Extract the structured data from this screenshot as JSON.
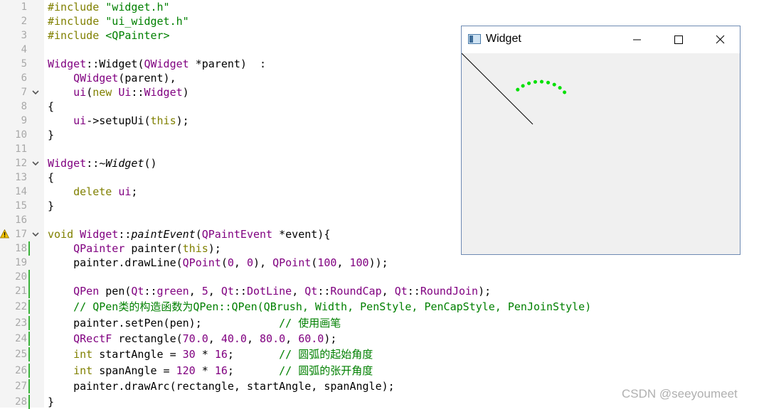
{
  "editor": {
    "lines": [
      {
        "n": "1",
        "fold": false,
        "warn": false,
        "mod": false,
        "tokens": [
          [
            "kw",
            "#include "
          ],
          [
            "str",
            "\"widget.h\""
          ]
        ]
      },
      {
        "n": "2",
        "fold": false,
        "warn": false,
        "mod": false,
        "tokens": [
          [
            "kw",
            "#include "
          ],
          [
            "str",
            "\"ui_widget.h\""
          ]
        ]
      },
      {
        "n": "3",
        "fold": false,
        "warn": false,
        "mod": false,
        "tokens": [
          [
            "kw",
            "#include "
          ],
          [
            "str",
            "<QPainter>"
          ]
        ]
      },
      {
        "n": "4",
        "fold": false,
        "warn": false,
        "mod": false,
        "tokens": []
      },
      {
        "n": "5",
        "fold": false,
        "warn": false,
        "mod": false,
        "tokens": [
          [
            "typ",
            "Widget"
          ],
          [
            "",
            "::"
          ],
          [
            "",
            "Widget"
          ],
          [
            "",
            "("
          ],
          [
            "typ",
            "QWidget"
          ],
          [
            "",
            " *parent)  :"
          ]
        ]
      },
      {
        "n": "6",
        "fold": false,
        "warn": false,
        "mod": false,
        "tokens": [
          [
            "",
            "    "
          ],
          [
            "typ",
            "QWidget"
          ],
          [
            "",
            "(parent),"
          ]
        ]
      },
      {
        "n": "7",
        "fold": true,
        "warn": false,
        "mod": false,
        "tokens": [
          [
            "",
            "    "
          ],
          [
            "typ",
            "ui"
          ],
          [
            "",
            "("
          ],
          [
            "kw",
            "new "
          ],
          [
            "typ",
            "Ui"
          ],
          [
            "",
            "::"
          ],
          [
            "typ",
            "Widget"
          ],
          [
            "",
            ")"
          ]
        ]
      },
      {
        "n": "8",
        "fold": false,
        "warn": false,
        "mod": false,
        "tokens": [
          [
            "",
            "{"
          ]
        ]
      },
      {
        "n": "9",
        "fold": false,
        "warn": false,
        "mod": false,
        "tokens": [
          [
            "",
            "    "
          ],
          [
            "typ",
            "ui"
          ],
          [
            "",
            "->setupUi("
          ],
          [
            "kw",
            "this"
          ],
          [
            "",
            ");"
          ]
        ]
      },
      {
        "n": "10",
        "fold": false,
        "warn": false,
        "mod": false,
        "tokens": [
          [
            "",
            "}"
          ]
        ]
      },
      {
        "n": "11",
        "fold": false,
        "warn": false,
        "mod": false,
        "tokens": []
      },
      {
        "n": "12",
        "fold": true,
        "warn": false,
        "mod": false,
        "tokens": [
          [
            "typ",
            "Widget"
          ],
          [
            "",
            "::~"
          ],
          [
            "it",
            "Widget"
          ],
          [
            "",
            "()"
          ]
        ]
      },
      {
        "n": "13",
        "fold": false,
        "warn": false,
        "mod": false,
        "tokens": [
          [
            "",
            "{"
          ]
        ]
      },
      {
        "n": "14",
        "fold": false,
        "warn": false,
        "mod": false,
        "tokens": [
          [
            "",
            "    "
          ],
          [
            "kw",
            "delete "
          ],
          [
            "typ",
            "ui"
          ],
          [
            "",
            ";"
          ]
        ]
      },
      {
        "n": "15",
        "fold": false,
        "warn": false,
        "mod": false,
        "tokens": [
          [
            "",
            "}"
          ]
        ]
      },
      {
        "n": "16",
        "fold": false,
        "warn": false,
        "mod": false,
        "tokens": []
      },
      {
        "n": "17",
        "fold": true,
        "warn": true,
        "mod": false,
        "tokens": [
          [
            "kw",
            "void "
          ],
          [
            "typ",
            "Widget"
          ],
          [
            "",
            "::"
          ],
          [
            "it",
            "paintEvent"
          ],
          [
            "",
            "("
          ],
          [
            "typ",
            "QPaintEvent"
          ],
          [
            "",
            " *event){"
          ]
        ]
      },
      {
        "n": "18",
        "fold": false,
        "warn": false,
        "mod": true,
        "tokens": [
          [
            "",
            "    "
          ],
          [
            "typ",
            "QPainter"
          ],
          [
            "",
            " painter("
          ],
          [
            "kw",
            "this"
          ],
          [
            "",
            ");"
          ]
        ]
      },
      {
        "n": "19",
        "fold": false,
        "warn": false,
        "mod": false,
        "tokens": [
          [
            "",
            "    painter.drawLine("
          ],
          [
            "typ",
            "QPoint"
          ],
          [
            "",
            "("
          ],
          [
            "typ",
            "0"
          ],
          [
            "",
            ", "
          ],
          [
            "typ",
            "0"
          ],
          [
            "",
            "), "
          ],
          [
            "typ",
            "QPoint"
          ],
          [
            "",
            "("
          ],
          [
            "typ",
            "100"
          ],
          [
            "",
            ", "
          ],
          [
            "typ",
            "100"
          ],
          [
            "",
            "));"
          ]
        ]
      },
      {
        "n": "20",
        "fold": false,
        "warn": false,
        "mod": true,
        "tokens": []
      },
      {
        "n": "21",
        "fold": false,
        "warn": false,
        "mod": true,
        "tokens": [
          [
            "",
            "    "
          ],
          [
            "typ",
            "QPen"
          ],
          [
            "",
            " pen("
          ],
          [
            "typ",
            "Qt"
          ],
          [
            "",
            "::"
          ],
          [
            "typ",
            "green"
          ],
          [
            "",
            ", "
          ],
          [
            "typ",
            "5"
          ],
          [
            "",
            ", "
          ],
          [
            "typ",
            "Qt"
          ],
          [
            "",
            "::"
          ],
          [
            "typ",
            "DotLine"
          ],
          [
            "",
            ", "
          ],
          [
            "typ",
            "Qt"
          ],
          [
            "",
            "::"
          ],
          [
            "typ",
            "RoundCap"
          ],
          [
            "",
            ", "
          ],
          [
            "typ",
            "Qt"
          ],
          [
            "",
            "::"
          ],
          [
            "typ",
            "RoundJoin"
          ],
          [
            "",
            ");"
          ]
        ]
      },
      {
        "n": "22",
        "fold": false,
        "warn": false,
        "mod": true,
        "tokens": [
          [
            "cm",
            "    // QPen类的构造函数为QPen::QPen(QBrush, Width, PenStyle, PenCapStyle, PenJoinStyle)"
          ]
        ]
      },
      {
        "n": "23",
        "fold": false,
        "warn": false,
        "mod": true,
        "tokens": [
          [
            "",
            "    painter.setPen(pen);            "
          ],
          [
            "cm",
            "// 使用画笔"
          ]
        ]
      },
      {
        "n": "24",
        "fold": false,
        "warn": false,
        "mod": true,
        "tokens": [
          [
            "",
            "    "
          ],
          [
            "typ",
            "QRectF"
          ],
          [
            "",
            " rectangle("
          ],
          [
            "typ",
            "70.0"
          ],
          [
            "",
            ", "
          ],
          [
            "typ",
            "40.0"
          ],
          [
            "",
            ", "
          ],
          [
            "typ",
            "80.0"
          ],
          [
            "",
            ", "
          ],
          [
            "typ",
            "60.0"
          ],
          [
            "",
            ");"
          ]
        ]
      },
      {
        "n": "25",
        "fold": false,
        "warn": false,
        "mod": true,
        "tokens": [
          [
            "",
            "    "
          ],
          [
            "kw",
            "int"
          ],
          [
            "",
            " startAngle = "
          ],
          [
            "typ",
            "30"
          ],
          [
            "",
            " * "
          ],
          [
            "typ",
            "16"
          ],
          [
            "",
            ";       "
          ],
          [
            "cm",
            "// 圆弧的起始角度"
          ]
        ]
      },
      {
        "n": "26",
        "fold": false,
        "warn": false,
        "mod": true,
        "tokens": [
          [
            "",
            "    "
          ],
          [
            "kw",
            "int"
          ],
          [
            "",
            " spanAngle = "
          ],
          [
            "typ",
            "120"
          ],
          [
            "",
            " * "
          ],
          [
            "typ",
            "16"
          ],
          [
            "",
            ";       "
          ],
          [
            "cm",
            "// 圆弧的张开角度"
          ]
        ]
      },
      {
        "n": "27",
        "fold": false,
        "warn": false,
        "mod": true,
        "tokens": [
          [
            "",
            "    painter.drawArc(rectangle, startAngle, spanAngle);"
          ]
        ]
      },
      {
        "n": "28",
        "fold": false,
        "warn": false,
        "mod": true,
        "tokens": [
          [
            "",
            "}"
          ]
        ]
      }
    ]
  },
  "widget_window": {
    "title": "Widget",
    "icon": "qt-window-icon",
    "controls": [
      "minimize-icon",
      "maximize-icon",
      "close-icon"
    ]
  },
  "colors": {
    "accent_line": "#000000",
    "arc_pen": "#00e000",
    "modified_marker": "#3bb33b"
  },
  "watermark": "CSDN @seeyoumeet"
}
